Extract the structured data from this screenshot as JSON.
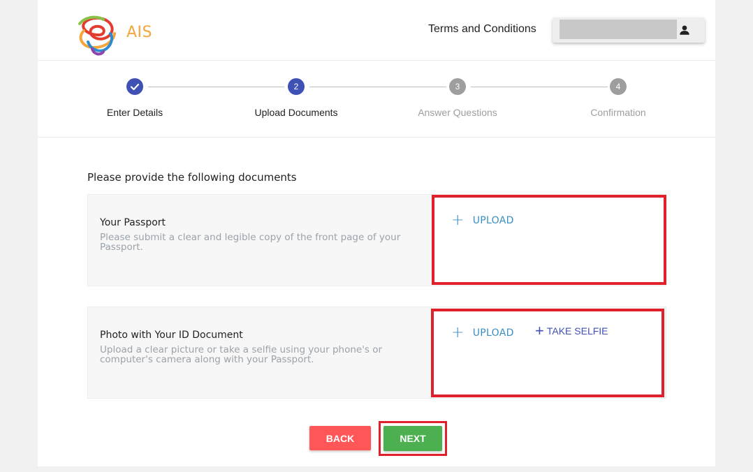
{
  "header": {
    "logo_text": "AIS",
    "terms_link": "Terms and Conditions",
    "user_name": ""
  },
  "stepper": {
    "steps": [
      {
        "number": "1",
        "label": "Enter Details",
        "state": "completed"
      },
      {
        "number": "2",
        "label": "Upload Documents",
        "state": "active"
      },
      {
        "number": "3",
        "label": "Answer Questions",
        "state": "inactive"
      },
      {
        "number": "4",
        "label": "Confirmation",
        "state": "inactive"
      }
    ]
  },
  "content": {
    "section_title": "Please provide the following documents",
    "documents": [
      {
        "title": "Your Passport",
        "description": "Please submit a clear and legible copy of the front page of your Passport.",
        "upload_label": "UPLOAD"
      },
      {
        "title": "Photo with Your ID Document",
        "description": "Upload a clear picture or take a selfie using your phone's or computer's camera along with your Passport.",
        "upload_label": "UPLOAD",
        "selfie_label": "TAKE SELFIE"
      }
    ]
  },
  "actions": {
    "back_label": "BACK",
    "next_label": "NEXT"
  },
  "colors": {
    "primary": "#3f51b5",
    "upload_blue": "#3b8ec2",
    "back_red": "#ff5757",
    "next_green": "#4caf50",
    "highlight_red": "#e0202a"
  }
}
